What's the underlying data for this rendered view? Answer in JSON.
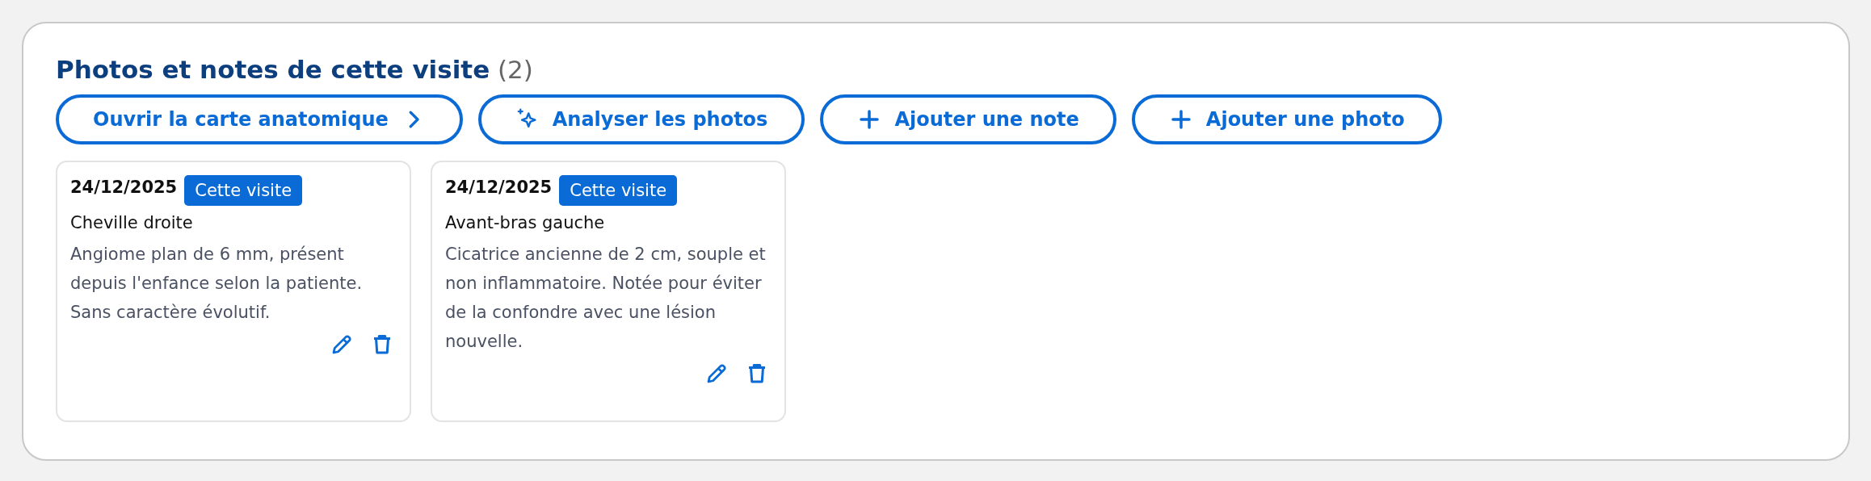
{
  "panel": {
    "title": "Photos et notes de cette visite",
    "count": "(2)"
  },
  "actions": [
    {
      "label": "Ouvrir la carte anatomique",
      "kind": "navigate"
    },
    {
      "label": "Analyser les photos",
      "kind": "analyze"
    },
    {
      "label": "Ajouter une note",
      "kind": "add"
    },
    {
      "label": "Ajouter une photo",
      "kind": "add"
    }
  ],
  "notes": [
    {
      "date": "24/12/2025",
      "badge": "Cette visite",
      "location": "Cheville droite",
      "text": "Angiome plan de 6 mm, présent depuis l'enfance selon la patiente. Sans caractère évolutif."
    },
    {
      "date": "24/12/2025",
      "badge": "Cette visite",
      "location": "Avant-bras gauche",
      "text": "Cicatrice ancienne de 2 cm, souple et non inflammatoire. Notée pour éviter de la confondre avec une lésion nouvelle."
    }
  ]
}
